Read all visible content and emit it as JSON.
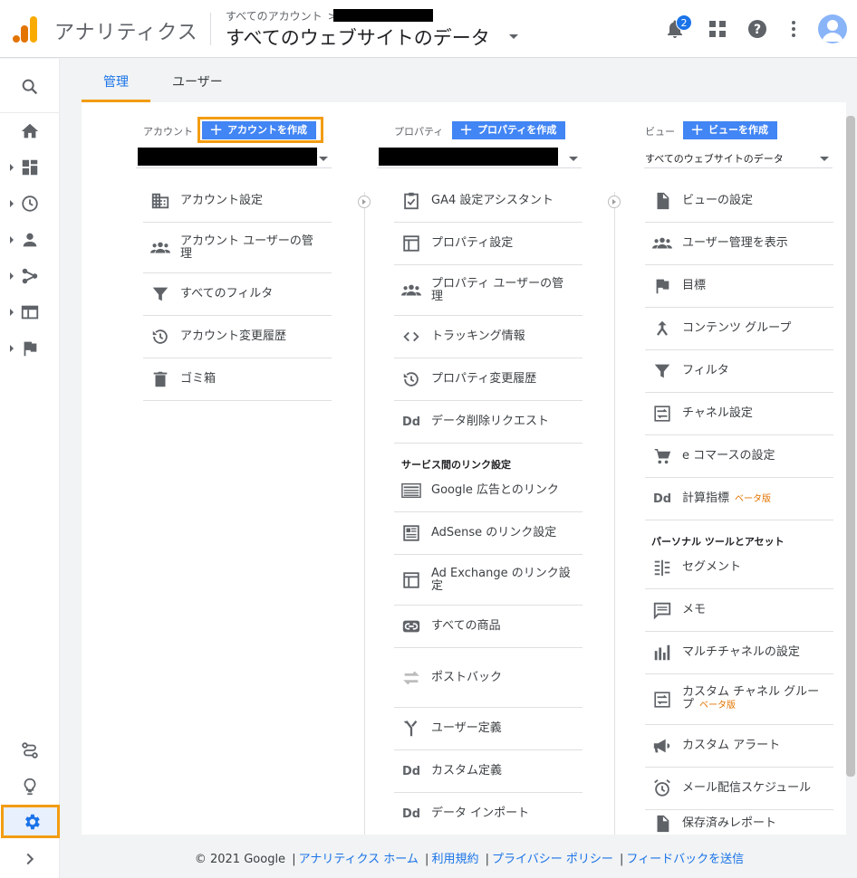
{
  "header": {
    "app_name": "アナリティクス",
    "breadcrumb": "すべてのアカウント",
    "breadcrumb_arrow": ">",
    "property_title": "すべてのウェブサイトのデータ",
    "notification_count": "2"
  },
  "tabs": {
    "admin": "管理",
    "user": "ユーザー"
  },
  "account": {
    "label": "アカウント",
    "create_button": "アカウントを作成",
    "items": [
      {
        "label": "アカウント設定",
        "icon": "building-icon"
      },
      {
        "label": "アカウント ユーザーの管理",
        "icon": "people-icon"
      },
      {
        "label": "すべてのフィルタ",
        "icon": "filter-icon"
      },
      {
        "label": "アカウント変更履歴",
        "icon": "history-icon"
      },
      {
        "label": "ゴミ箱",
        "icon": "trash-icon"
      }
    ]
  },
  "property": {
    "label": "プロパティ",
    "create_button": "プロパティを作成",
    "items": [
      {
        "label": "GA4 設定アシスタント",
        "icon": "clipboard-check-icon"
      },
      {
        "label": "プロパティ設定",
        "icon": "layout-icon"
      },
      {
        "label": "プロパティ ユーザーの管理",
        "icon": "people-icon"
      },
      {
        "label": "トラッキング情報",
        "icon": "code-icon"
      },
      {
        "label": "プロパティ変更履歴",
        "icon": "history-icon"
      },
      {
        "label": "データ削除リクエスト",
        "icon": "dd-icon"
      }
    ],
    "section": "サービス間のリンク設定",
    "link_items": [
      {
        "label": "Google 広告とのリンク",
        "icon": "ads-icon"
      },
      {
        "label": "AdSense のリンク設定",
        "icon": "adsense-icon"
      },
      {
        "label": "Ad Exchange のリンク設定",
        "icon": "layout-icon"
      },
      {
        "label": "すべての商品",
        "icon": "link-icon"
      },
      {
        "label": "ポストバック",
        "icon": "swap-icon"
      },
      {
        "label": "ユーザー定義",
        "icon": "fork-icon"
      },
      {
        "label": "カスタム定義",
        "icon": "dd-icon"
      },
      {
        "label": "データ インポート",
        "icon": "dd-icon"
      }
    ]
  },
  "view": {
    "label": "ビュー",
    "create_button": "ビューを作成",
    "selected": "すべてのウェブサイトのデータ",
    "items": [
      {
        "label": "ビューの設定",
        "icon": "file-icon"
      },
      {
        "label": "ユーザー管理を表示",
        "icon": "people-icon"
      },
      {
        "label": "目標",
        "icon": "flag-icon"
      },
      {
        "label": "コンテンツ グループ",
        "icon": "merge-icon"
      },
      {
        "label": "フィルタ",
        "icon": "filter-icon"
      },
      {
        "label": "チャネル設定",
        "icon": "channel-icon"
      },
      {
        "label": "e コマースの設定",
        "icon": "cart-icon"
      },
      {
        "label": "計算指標",
        "icon": "dd-icon",
        "beta": "ベータ版"
      }
    ],
    "section": "パーソナル ツールとアセット",
    "personal_items": [
      {
        "label": "セグメント",
        "icon": "segment-icon"
      },
      {
        "label": "メモ",
        "icon": "comment-icon"
      },
      {
        "label": "マルチチャネルの設定",
        "icon": "bar-chart-icon"
      },
      {
        "label": "カスタム チャネル グループ",
        "icon": "channel-icon",
        "beta": "ベータ版"
      },
      {
        "label": "カスタム アラート",
        "icon": "megaphone-icon"
      },
      {
        "label": "メール配信スケジュール",
        "icon": "alarm-icon"
      },
      {
        "label": "保存済みレポート",
        "icon": "file-icon"
      }
    ]
  },
  "footer": {
    "copyright": "© 2021 Google",
    "links": [
      "アナリティクス ホーム",
      "利用規約",
      "プライバシー ポリシー",
      "フィードバックを送信"
    ]
  },
  "colors": {
    "accent": "#1a73e8",
    "highlight": "#f39c12",
    "button": "#4285f4",
    "beta": "#e37400"
  }
}
